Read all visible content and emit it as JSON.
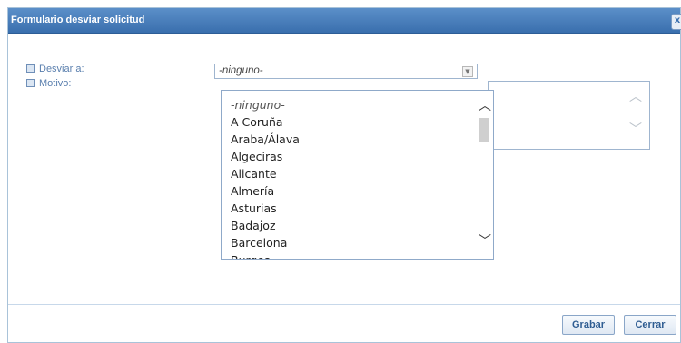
{
  "dialog": {
    "title": "Formulario desviar solicitud",
    "close_label": "x"
  },
  "form": {
    "desviar_label": "Desviar a:",
    "motivo_label": "Motivo:",
    "desviar_value": "-ninguno-",
    "options": [
      "-ninguno-",
      "A Coruña",
      "Araba/Álava",
      "Algeciras",
      "Alicante",
      "Almería",
      "Asturias",
      "Badajoz",
      "Barcelona",
      "Burgos"
    ]
  },
  "buttons": {
    "grabar": "Grabar",
    "cerrar": "Cerrar"
  },
  "icons": {
    "dropdown_arrow": "chevron-down-icon",
    "scroll_up": "chevron-up-icon",
    "scroll_down": "chevron-down-icon",
    "close": "close-icon"
  }
}
